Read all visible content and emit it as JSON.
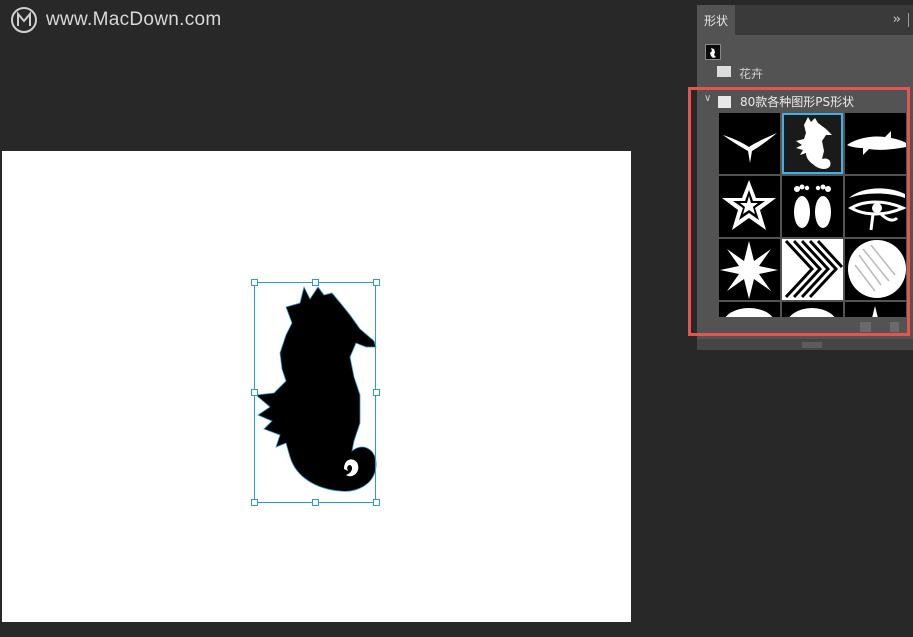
{
  "watermark": {
    "text": "www.MacDown.com",
    "logo_icon": "macdown-m-logo"
  },
  "document": {
    "canvas_color": "#ffffff",
    "selected_shape": "seahorse",
    "transform_color": "#2b9bd6"
  },
  "shapes_panel": {
    "tab_label": "形状",
    "collapse_glyph": "››",
    "previous_group_label": "花卉",
    "group_label": "80款各种图形PS形状",
    "group_chevron": "∨",
    "highlight_color": "#e2564f",
    "selection_color": "#3fb0e8",
    "shapes": [
      {
        "name": "bird",
        "selected": false
      },
      {
        "name": "seahorse",
        "selected": true
      },
      {
        "name": "dolphin",
        "selected": false
      },
      {
        "name": "star-outline",
        "selected": false
      },
      {
        "name": "footprints",
        "selected": false
      },
      {
        "name": "eye-of-horus",
        "selected": false
      },
      {
        "name": "compass-star",
        "selected": false
      },
      {
        "name": "chevron-pattern",
        "selected": false
      },
      {
        "name": "halftone-circle",
        "selected": false
      },
      {
        "name": "partial-shape-1",
        "selected": false
      },
      {
        "name": "partial-shape-2",
        "selected": false
      },
      {
        "name": "partial-shape-3",
        "selected": false
      }
    ],
    "footer_icons": [
      "new-group-icon",
      "delete-icon"
    ]
  }
}
